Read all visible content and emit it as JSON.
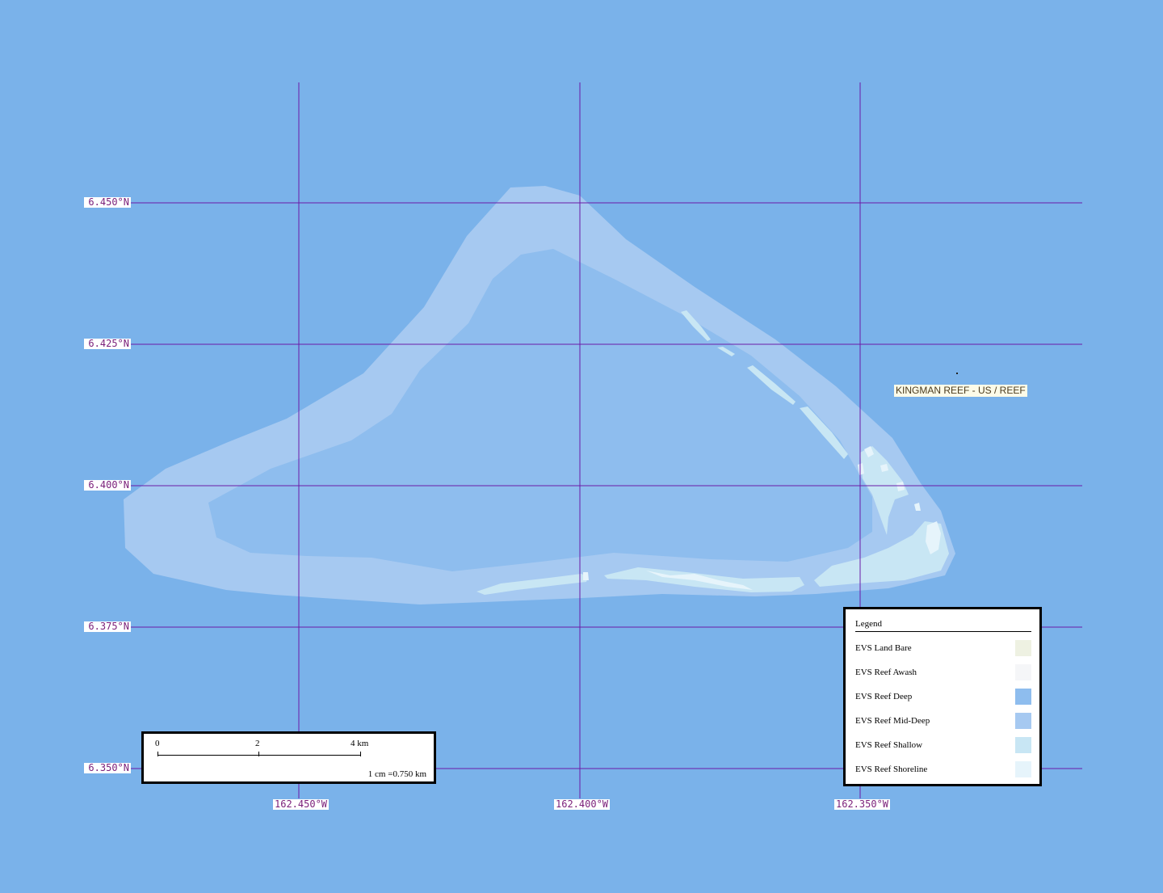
{
  "map": {
    "colors": {
      "ocean": "#7ab2ea",
      "grid": "#6a1aa8",
      "reef_mid_deep": "#a6c9f1",
      "reef_deep": "#8ebdee",
      "reef_shallow": "#c8e6f4",
      "reef_shoreline": "#e6f4fb",
      "land_bare": "#eef1e2",
      "reef_awash": "#f5f6f8"
    },
    "latitude_labels": [
      "6.450°N",
      "6.425°N",
      "6.400°N",
      "6.375°N",
      "6.350°N"
    ],
    "longitude_labels": [
      "162.450°W",
      "162.400°W",
      "162.350°W"
    ],
    "place_label": "KINGMAN REEF - US / REEF"
  },
  "scale_bar": {
    "ticks": [
      "0",
      "2",
      "4 km"
    ],
    "ratio": "1 cm =0.750 km"
  },
  "legend": {
    "title": "Legend",
    "items": [
      {
        "label": "EVS Land Bare",
        "color": "#eef1e2"
      },
      {
        "label": "EVS Reef Awash",
        "color": "#f5f6f8"
      },
      {
        "label": "EVS Reef Deep",
        "color": "#8ebdee"
      },
      {
        "label": "EVS Reef Mid-Deep",
        "color": "#a6c9f1"
      },
      {
        "label": "EVS Reef Shallow",
        "color": "#c8e6f4"
      },
      {
        "label": "EVS Reef Shoreline",
        "color": "#e6f4fb"
      }
    ]
  }
}
